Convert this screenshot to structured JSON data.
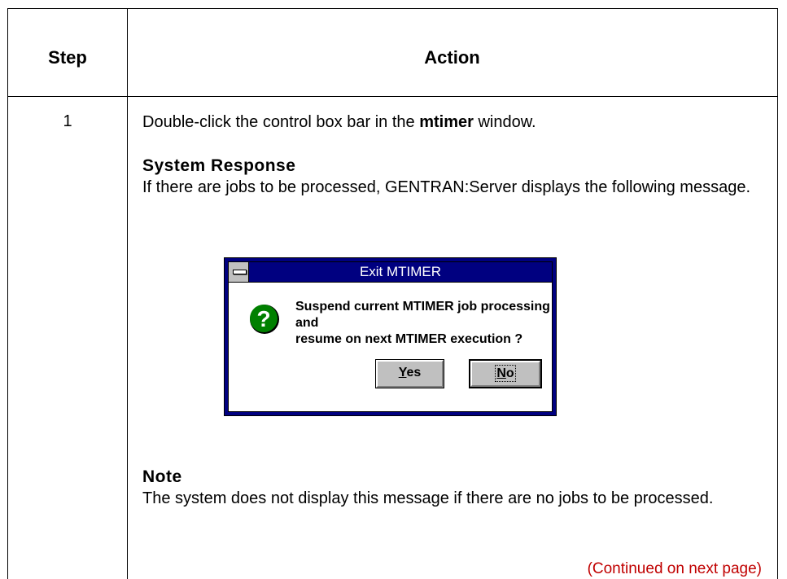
{
  "table": {
    "header_step": "Step",
    "header_action": "Action"
  },
  "step": {
    "number": "1",
    "instruction_prefix": "Double-click the control box bar in the ",
    "instruction_bold": "mtimer",
    "instruction_suffix": " window.",
    "system_response_heading": "System Response",
    "system_response_text": "If there are jobs to be processed, GENTRAN:Server displays the following message.",
    "note_heading": "Note",
    "note_text": "The system does not display this message if there are no jobs to be processed.",
    "continued": "(Continued on next page)"
  },
  "dialog": {
    "title": "Exit MTIMER",
    "message_line1": "Suspend current MTIMER job processing and",
    "message_line2": "resume on next MTIMER execution ?",
    "yes_mnemonic": "Y",
    "yes_rest": "es",
    "no_mnemonic": "N",
    "no_rest": "o",
    "icon": "question-icon",
    "title_bar_color": "#000080",
    "icon_color": "#008000"
  },
  "colors": {
    "continued_text": "#c00000"
  }
}
